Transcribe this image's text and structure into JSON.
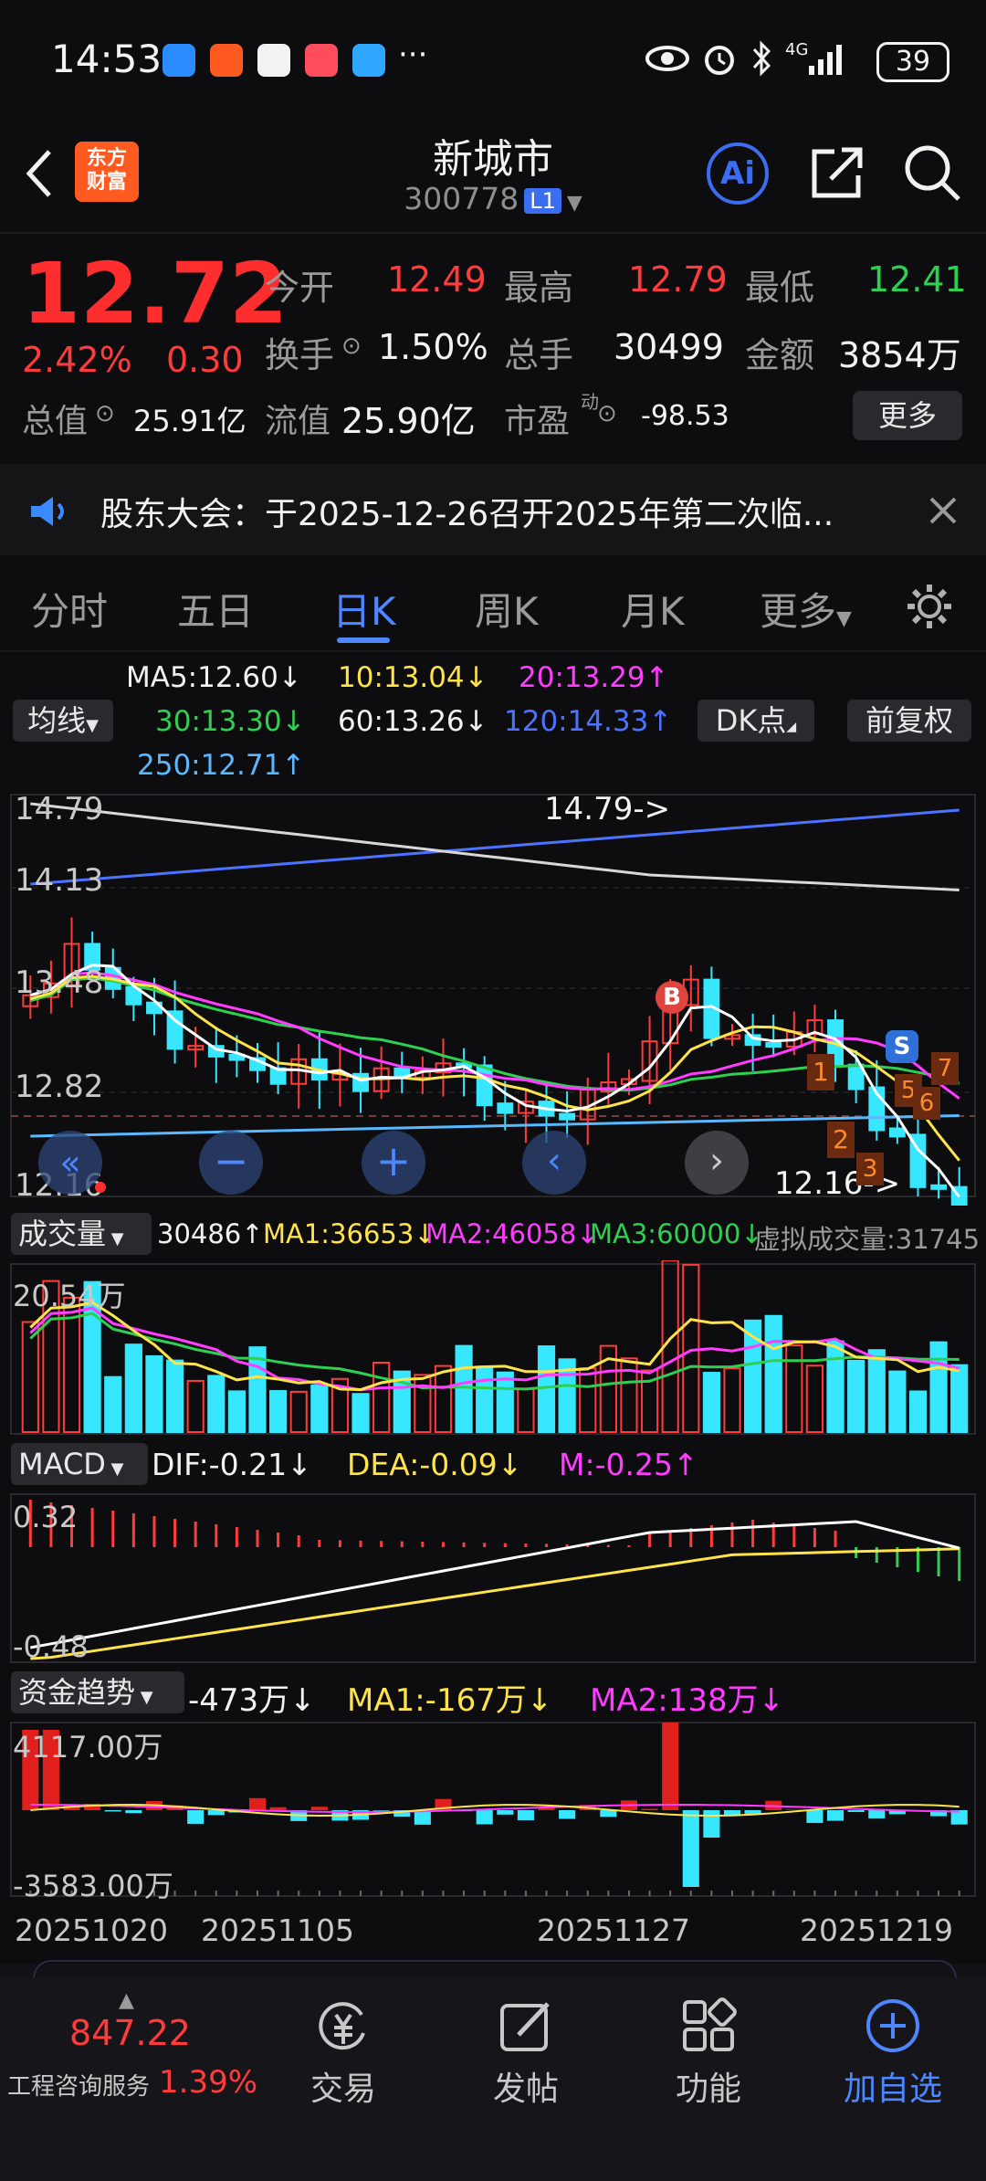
{
  "status_bar": {
    "time": "14:53",
    "battery": "39",
    "dots": "···",
    "network": "4G"
  },
  "header": {
    "logo": "东方\n财富",
    "logo_l1": "东方",
    "logo_l2": "财富",
    "stock_name": "新城市",
    "stock_code": "300778",
    "level_badge": "L1",
    "ai_label": "Ai"
  },
  "quote": {
    "price": "12.72",
    "change_pct": "2.42%",
    "change": "0.30",
    "open_label": "今开",
    "open": "12.49",
    "high_label": "最高",
    "high": "12.79",
    "low_label": "最低",
    "low": "12.41",
    "turnover_label": "换手",
    "turnover": "1.50%",
    "volume_label": "总手",
    "volume": "30499",
    "amount_label": "金额",
    "amount": "3854万",
    "mktcap_label": "总值",
    "mktcap": "25.91亿",
    "float_label": "流值",
    "float_cap": "25.90亿",
    "pe_label": "市盈",
    "pe_sup": "动",
    "pe": "-98.53",
    "more": "更多"
  },
  "notice": {
    "text": "股东大会：于2025-12-26召开2025年第二次临..."
  },
  "tabs": [
    "分时",
    "五日",
    "日K",
    "周K",
    "月K",
    "更多"
  ],
  "active_tab": 2,
  "ma_legend": {
    "selector": "均线",
    "ma5": "MA5:12.60↓",
    "ma10": "10:13.04↓",
    "ma20": "20:13.29↑",
    "ma30": "30:13.30↓",
    "ma60": "60:13.26↓",
    "ma120": "120:14.33↑",
    "ma250": "250:12.71↑",
    "dk_button": "DK点",
    "adjust_button": "前复权",
    "colors": {
      "ma5": "#ffffff",
      "ma10": "#ffe34a",
      "ma20": "#ff3cff",
      "ma30": "#2fcf52",
      "ma60": "#ffffff",
      "ma120": "#4b73ff",
      "ma250": "#5ab8ff"
    }
  },
  "kline": {
    "y_labels": [
      "14.79",
      "14.13",
      "13.48",
      "12.82",
      "12.16"
    ],
    "high_marker": "14.79->",
    "low_marker": "12.16->",
    "signal_b": "B",
    "signal_s": "S",
    "count_labels": [
      "1",
      "2",
      "3",
      "5",
      "6",
      "7"
    ]
  },
  "volume": {
    "selector": "成交量",
    "value": "30486↑",
    "ma1": "MA1:36653↓",
    "ma2": "MA2:46058↓",
    "ma3": "MA3:60000↓",
    "virtual": "虚拟成交量:31745",
    "y_label": "20.54万"
  },
  "macd": {
    "selector": "MACD",
    "dif": "DIF:-0.21↓",
    "dea": "DEA:-0.09↓",
    "m": "M:-0.25↑",
    "y_top": "0.32",
    "y_bottom": "-0.48"
  },
  "fund": {
    "selector": "资金趋势",
    "value": "-473万↓",
    "ma1": "MA1:-167万↓",
    "ma2": "MA2:138万↓",
    "y_top": "4117.00万",
    "y_bottom": "-3583.00万"
  },
  "dates": [
    "20251020",
    "20251105",
    "20251127",
    "20251219"
  ],
  "bottom_nav": {
    "index_value": "847.22",
    "index_name": "工程咨询服务",
    "index_change": "1.39%",
    "items": [
      {
        "label": "交易",
        "icon": "trade-icon"
      },
      {
        "label": "发帖",
        "icon": "post-icon"
      },
      {
        "label": "功能",
        "icon": "grid-icon"
      },
      {
        "label": "加自选",
        "icon": "add-icon"
      }
    ]
  }
}
